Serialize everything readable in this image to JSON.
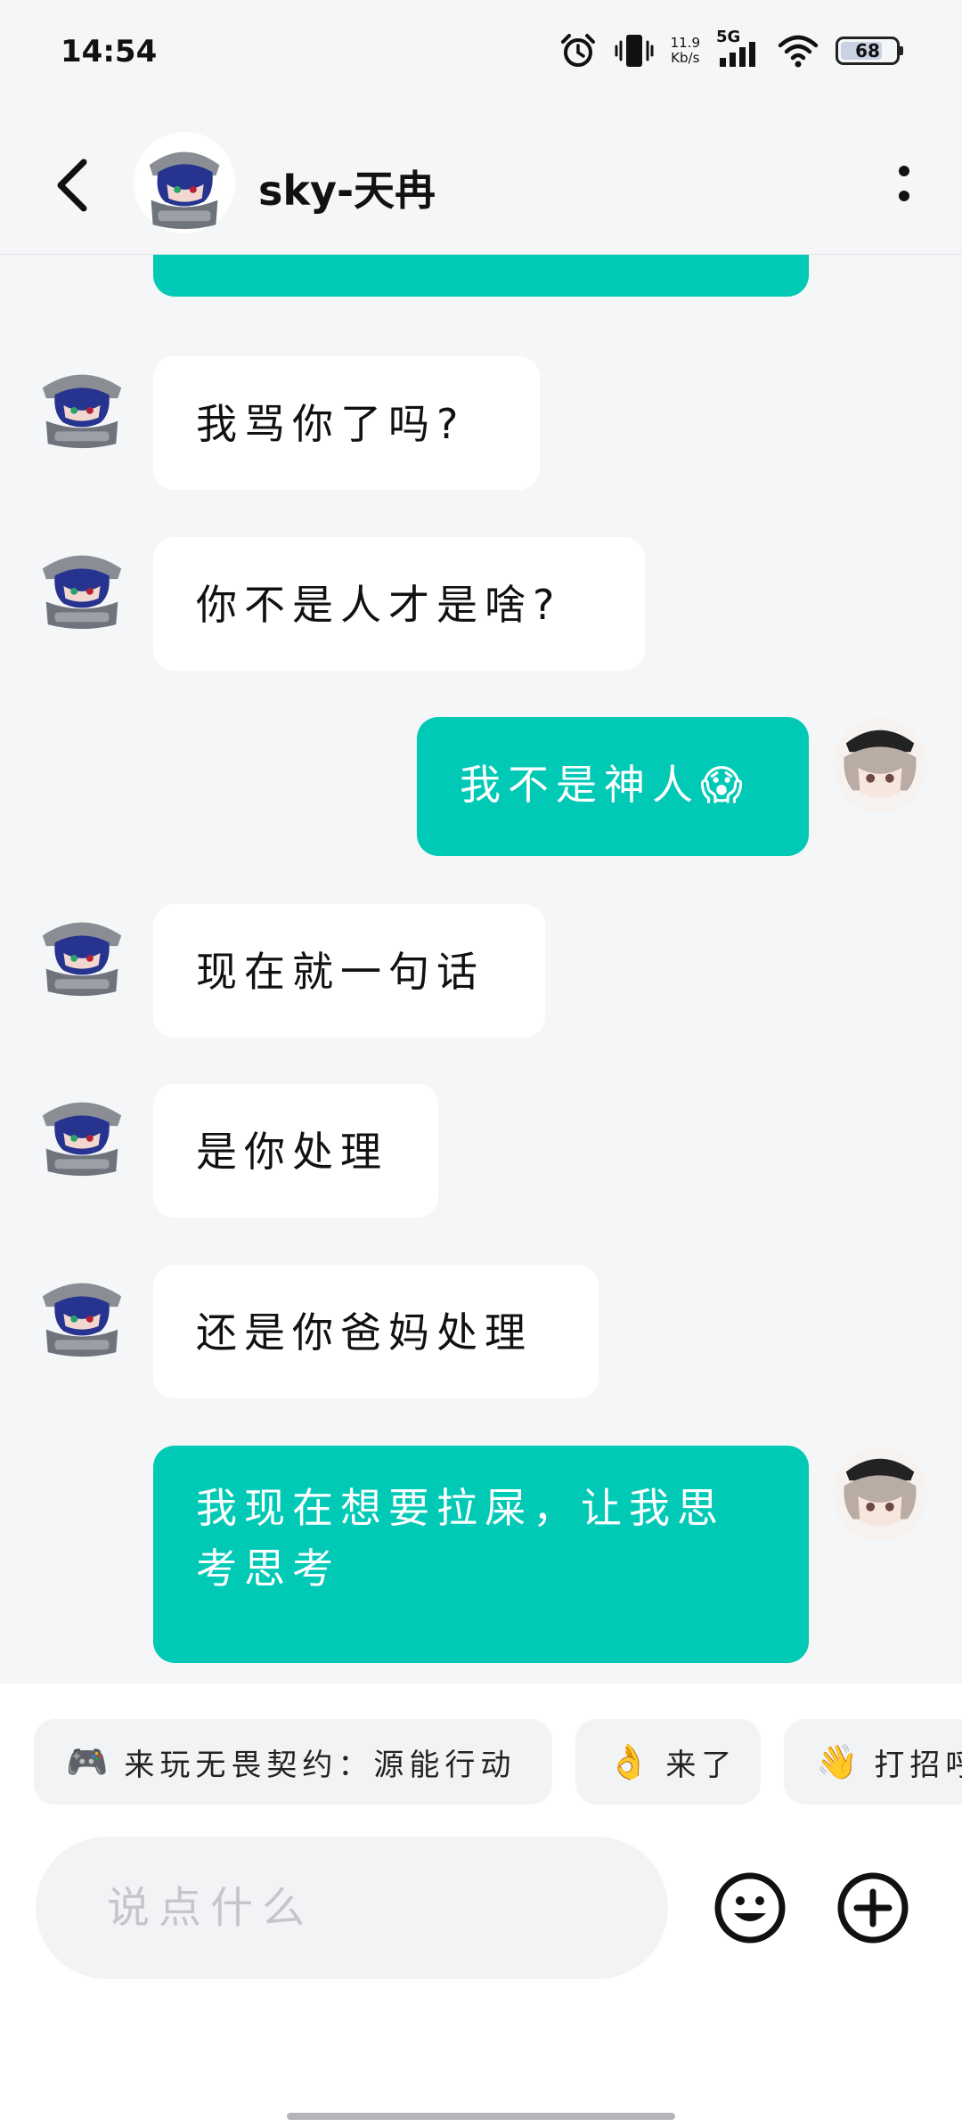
{
  "status_bar": {
    "time": "14:54",
    "net_speed_value": "11.9",
    "net_speed_unit": "Kb/s",
    "network_type": "5G",
    "battery": "68"
  },
  "header": {
    "contact_name": "sky-天冉"
  },
  "messages": [
    {
      "side": "out",
      "text": "我不是神人😱"
    },
    {
      "side": "in",
      "text": "我骂你了吗?"
    },
    {
      "side": "in",
      "text": "你不是人才是啥?"
    },
    {
      "side": "in",
      "text": "现在就一句话"
    },
    {
      "side": "in",
      "text": "是你处理"
    },
    {
      "side": "in",
      "text": "还是你爸妈处理"
    },
    {
      "side": "out",
      "text": "我现在想要拉屎，让我思考思考"
    }
  ],
  "quick_replies": [
    {
      "icon": "🎮",
      "label": "来玩无畏契约：源能行动"
    },
    {
      "icon": "👌",
      "label": "来了"
    },
    {
      "icon": "👋",
      "label": "打招呼"
    }
  ],
  "composer": {
    "placeholder": "说点什么"
  },
  "colors": {
    "outgoing_bubble": "#00c9b6",
    "incoming_bubble": "#ffffff",
    "background": "#f5f6f8"
  }
}
